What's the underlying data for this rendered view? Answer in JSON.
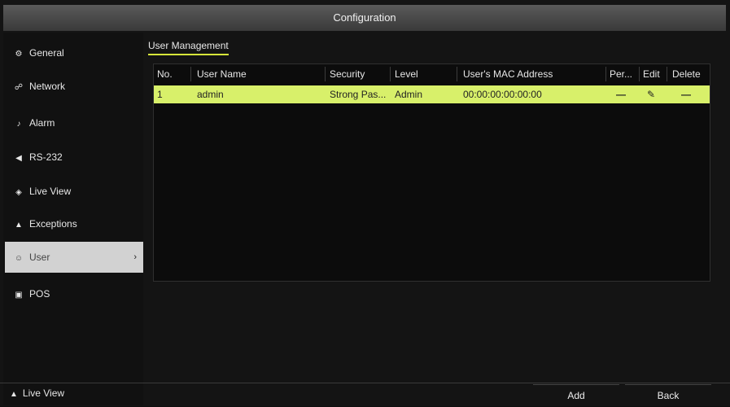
{
  "header": {
    "title": "Configuration"
  },
  "sidebar": {
    "items": [
      {
        "label": "General",
        "icon": "gear-icon",
        "glyph": "⚙"
      },
      {
        "label": "Network",
        "icon": "network-icon",
        "glyph": "☍"
      },
      {
        "label": "Alarm",
        "icon": "alarm-icon",
        "glyph": "♪"
      },
      {
        "label": "RS-232",
        "icon": "rs232-icon",
        "glyph": "◀"
      },
      {
        "label": "Live View",
        "icon": "eye-icon",
        "glyph": "◈"
      },
      {
        "label": "Exceptions",
        "icon": "warning-icon",
        "glyph": "▲"
      },
      {
        "label": "User",
        "icon": "user-icon",
        "glyph": "☺"
      },
      {
        "label": "POS",
        "icon": "pos-icon",
        "glyph": "▣"
      }
    ],
    "active_index": 6,
    "chevron": "›"
  },
  "footer": {
    "liveview_label": "Live View",
    "liveview_glyph": "▲",
    "add_label": "Add",
    "back_label": "Back"
  },
  "main": {
    "tab_label": "User Management",
    "columns": [
      "No.",
      "User Name",
      "Security",
      "Level",
      "User's MAC Address",
      "Per...",
      "Edit",
      "Delete"
    ],
    "rows": [
      {
        "no": "1",
        "user_name": "admin",
        "security": "Strong Pas...",
        "level": "Admin",
        "mac": "00:00:00:00:00:00",
        "per": "—",
        "edit": "✎",
        "delete": "—"
      }
    ]
  },
  "colors": {
    "accent": "#d8f06a",
    "active_nav": "#d2d2d2"
  }
}
